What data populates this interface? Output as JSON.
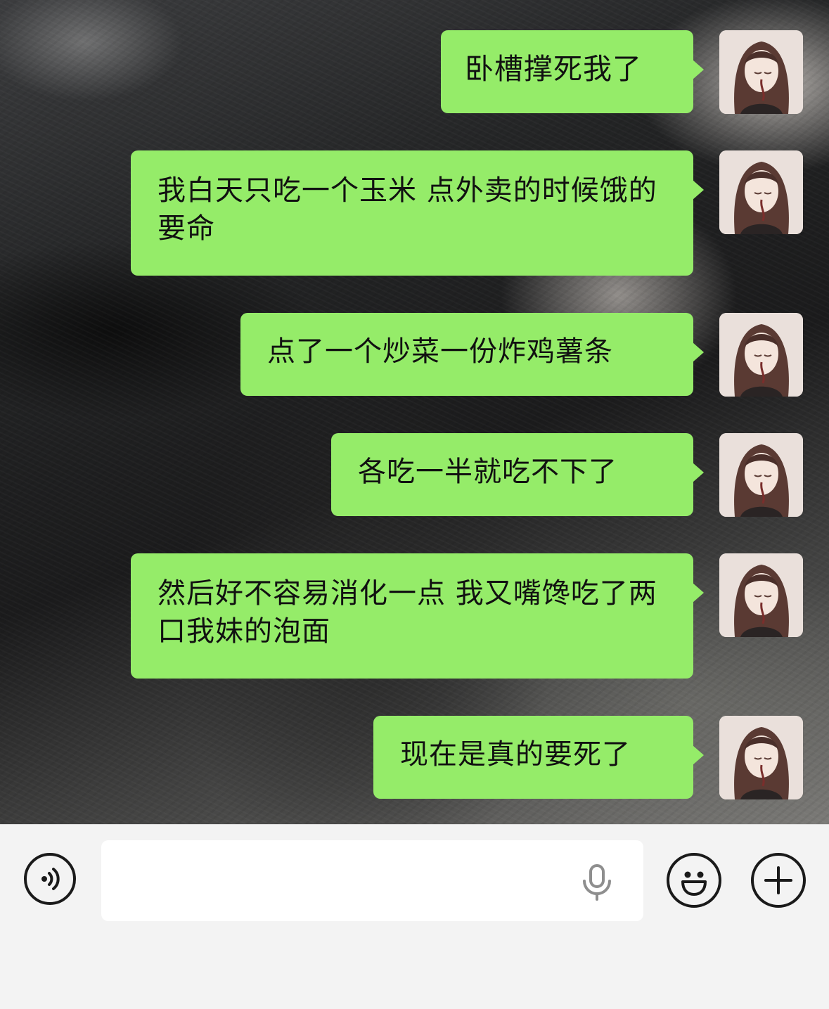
{
  "chat": {
    "messages": [
      {
        "text": "卧槽撑死我了",
        "sender": "self"
      },
      {
        "text": "我白天只吃一个玉米 点外卖的时候饿的要命",
        "sender": "self"
      },
      {
        "text": "点了一个炒菜一份炸鸡薯条",
        "sender": "self"
      },
      {
        "text": "各吃一半就吃不下了",
        "sender": "self"
      },
      {
        "text": "然后好不容易消化一点 我又嘴馋吃了两口我妹的泡面",
        "sender": "self"
      },
      {
        "text": "现在是真的要死了",
        "sender": "self"
      }
    ],
    "bubble_color": "#95ec69"
  },
  "input_bar": {
    "voice_toggle_icon": "voice-icon",
    "text_value": "",
    "mic_icon": "microphone-icon",
    "emoji_icon": "emoji-icon",
    "more_icon": "plus-icon"
  }
}
